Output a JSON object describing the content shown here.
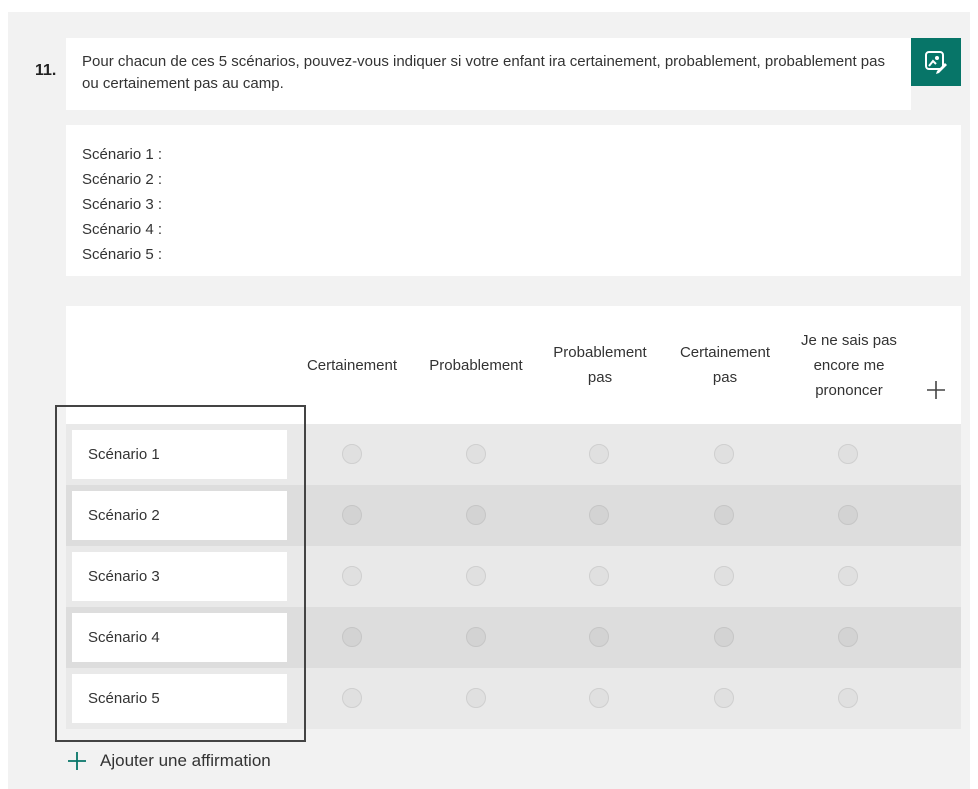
{
  "question": {
    "number": "11.",
    "title": "Pour chacun de ces 5 scénarios, pouvez-vous indiquer si votre enfant ira certainement, probablement, probablement pas ou certainement pas au camp.",
    "subtitle_lines": [
      "Scénario 1 :",
      "Scénario 2 :",
      "Scénario 3 :",
      "Scénario 4 :",
      "Scénario 5 :"
    ]
  },
  "likert": {
    "columns": [
      "Certainement",
      "Probablement",
      "Probablement pas",
      "Certainement pas",
      "Je ne sais pas encore me prononcer"
    ],
    "rows": [
      "Scénario 1",
      "Scénario 2",
      "Scénario 3",
      "Scénario 4",
      "Scénario 5"
    ],
    "add_statement_label": "Ajouter une affirmation"
  },
  "icons": {
    "edit": "edit-icon",
    "add_column": "plus-icon",
    "add_statement": "plus-icon"
  },
  "colors": {
    "accent": "#077568",
    "panel_bg": "#f2f2f2",
    "row_light": "#e9e9e9",
    "row_dark": "#dddddd"
  }
}
